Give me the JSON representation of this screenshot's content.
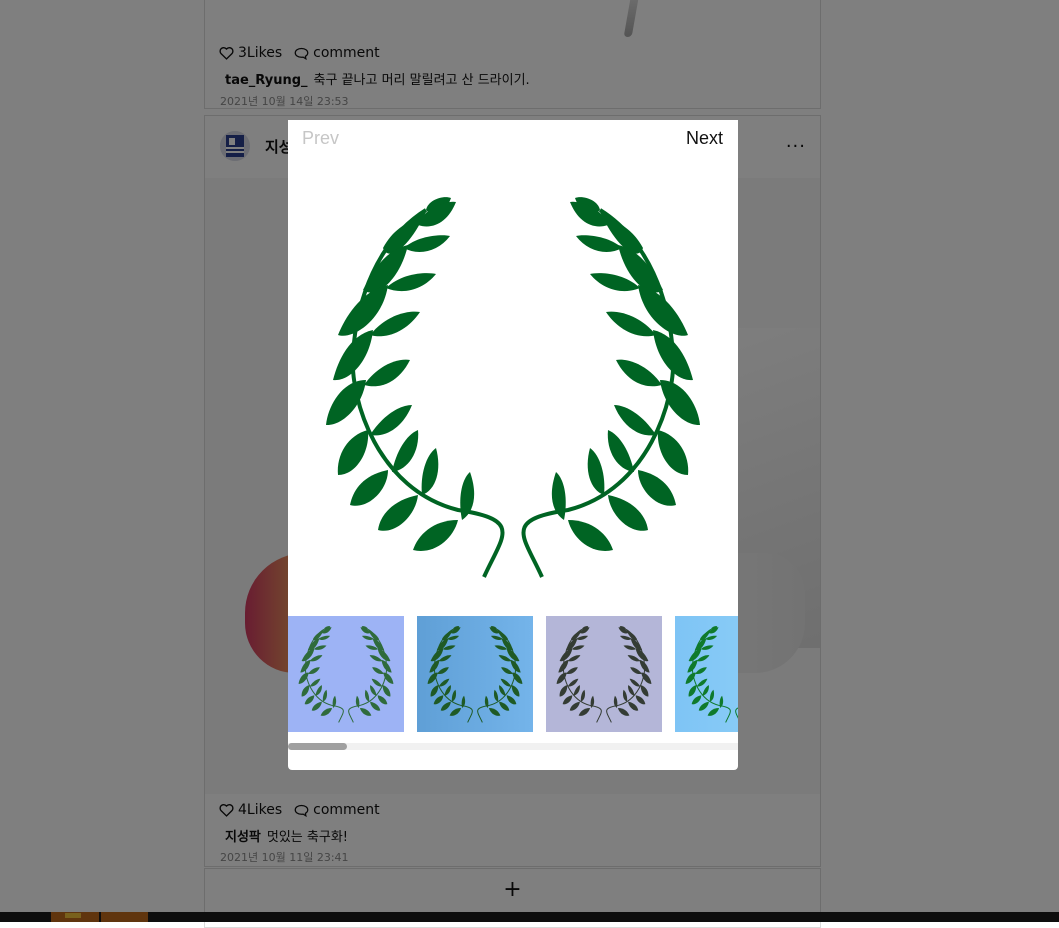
{
  "feed": {
    "post_top": {
      "likes": "3Likes",
      "comment_label": "comment",
      "author": "tae_Ryung_",
      "caption": "축구 끝나고 머리 말릴려고 산 드라이기.",
      "date": "2021년 10월 14일 23:53"
    },
    "post_main": {
      "author": "지성팍",
      "more_label": "...",
      "likes": "4Likes",
      "comment_label": "comment",
      "caption": "멋있는 축구화!",
      "date": "2021년 10월 11일 23:41"
    },
    "add_label": "+"
  },
  "modal": {
    "prev_label": "Prev",
    "next_label": "Next",
    "scroll_fraction": 0.13,
    "thumbnails": [
      {
        "name": "laurel-thumb-1",
        "bg": "#9db3f5",
        "bg2": "#9db3f5",
        "leaf": "#2f6b3c"
      },
      {
        "name": "laurel-thumb-2",
        "bg": "#5f9fd6",
        "bg2": "#74b4ea",
        "leaf": "#1f5a25"
      },
      {
        "name": "laurel-thumb-3",
        "bg": "#b4b6d8",
        "bg2": "#b4b6d8",
        "leaf": "#343c34"
      },
      {
        "name": "laurel-thumb-4",
        "bg": "#7ec4f5",
        "bg2": "#8fd0f7",
        "leaf": "#0f7a2c"
      }
    ]
  },
  "colors": {
    "laurel_green": "#006423",
    "overlay": "rgba(0,0,0,0.5)",
    "prev_disabled": "#c6c6c6"
  }
}
